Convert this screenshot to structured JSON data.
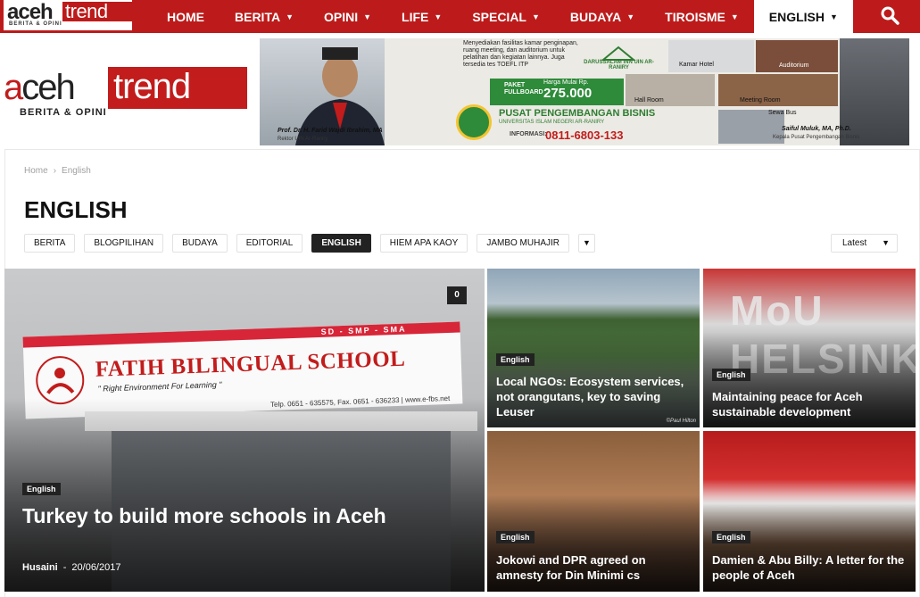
{
  "nav": {
    "logo": {
      "word1": "aceh",
      "word2": "trend",
      "tagline": "BERITA & OPINI"
    },
    "items": [
      {
        "label": "HOME",
        "dropdown": false
      },
      {
        "label": "BERITA",
        "dropdown": true
      },
      {
        "label": "OPINI",
        "dropdown": true
      },
      {
        "label": "LIFE",
        "dropdown": true
      },
      {
        "label": "SPECIAL",
        "dropdown": true
      },
      {
        "label": "BUDAYA",
        "dropdown": true
      },
      {
        "label": "TIROISME",
        "dropdown": true
      },
      {
        "label": "ENGLISH",
        "dropdown": true,
        "active": true
      }
    ],
    "search_icon": "search-icon",
    "color": "#bd1b1b"
  },
  "header": {
    "logo": {
      "word1": "aceh",
      "word2": "trend",
      "tagline": "BERITA & OPINI"
    },
    "banner": {
      "description": "Menyediakan fasilitas kamar penginapan, ruang meeting, dan auditorium untuk pelatihan dan kegiatan lainnya. Juga tersedia tes TOEFL ITP",
      "uin_label": "DARUSSALAM INN UIN AR-RANIRY",
      "paket_label": "PAKET FULLBOARD",
      "harga_label": "Harga Mulai Rp.",
      "price": "275.000",
      "center_name": "PUSAT PENGEMBANGAN BISNIS",
      "university": "UNIVERSITAS ISLAM NEGERI AR-RANIRY",
      "info_label": "INFORMASI:",
      "phone": "0811-6803-133",
      "left_caption": "Prof. Dr. H. Farid Wajdi Ibrahim, MA",
      "left_role": "Rektor UIN Ar-Raniry",
      "right_caption": "Saiful Muluk, MA, Ph.D.",
      "right_role": "Kepala Pusat Pengembangan Bisnis",
      "photo_labels": [
        "Kamar Hotel",
        "Auditorium",
        "Hall Room",
        "Meeting Room",
        "Sewa Bus"
      ]
    }
  },
  "content": {
    "breadcrumb": {
      "home": "Home",
      "current": "English"
    },
    "title": "ENGLISH",
    "filters": [
      "BERITA",
      "BLOGPILIHAN",
      "BUDAYA",
      "EDITORIAL",
      "ENGLISH",
      "HIEM APA KAOY",
      "JAMBO MUHAJIR"
    ],
    "active_filter": "ENGLISH",
    "sort_label": "Latest"
  },
  "articles": {
    "main": {
      "category": "English",
      "title": "Turkey to build more schools in Aceh",
      "author": "Husaini",
      "separator": "-",
      "date": "20/06/2017",
      "comments": "0",
      "image_sign": {
        "school_name": "FATIH BILINGUAL SCHOOL",
        "slogan": "\" Right Environment For Learning \"",
        "levels": "SD - SMP - SMA",
        "phone": "Telp. 0651 - 635575, Fax. 0651 - 636233 | www.e-fbs.net",
        "emblem_text": "FATIH BILINGUAL SCHOOL"
      }
    },
    "tiles": [
      {
        "category": "English",
        "title": "Local NGOs: Ecosystem services, not orangutans, key to saving Leuser",
        "credit": "©Paul Hilton"
      },
      {
        "category": "English",
        "title": "Maintaining peace for Aceh sustainable development",
        "backdrop_text": "MoU HELSINKI"
      },
      {
        "category": "English",
        "title": "Jokowi and DPR agreed on amnesty for Din Minimi cs"
      },
      {
        "category": "English",
        "title": "Damien & Abu Billy: A letter for the people of Aceh"
      }
    ]
  }
}
